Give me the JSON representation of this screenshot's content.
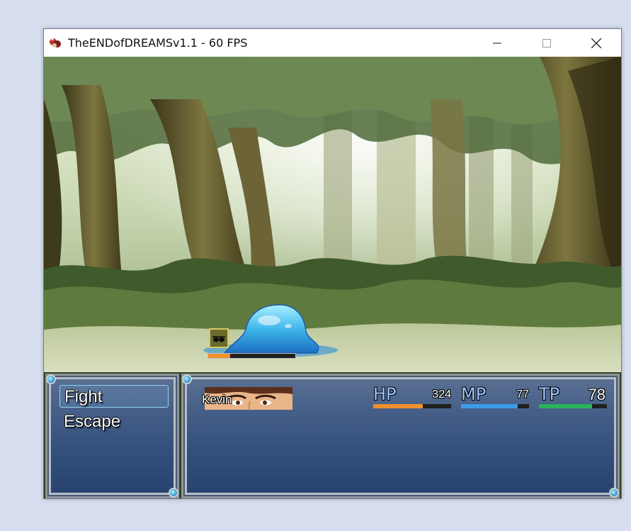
{
  "window": {
    "title": "TheENDofDREAMSv1.1 - 60 FPS",
    "controls": {
      "minimize_icon": "minimize-icon",
      "maximize_icon": "maximize-icon",
      "close_icon": "close-icon"
    }
  },
  "battle": {
    "commands": [
      {
        "label": "Fight",
        "selected": true
      },
      {
        "label": "Escape",
        "selected": false
      }
    ],
    "enemy": {
      "type": "slime",
      "state_icon": "sunglasses-icon",
      "gauge_fraction": 0.25
    },
    "actor": {
      "name": "Kevin",
      "hp_label": "HP",
      "hp": "324",
      "hp_fraction": 0.64,
      "mp_label": "MP",
      "mp": "77",
      "mp_fraction": 0.83,
      "tp_label": "TP",
      "tp": "78",
      "tp_fraction": 0.78
    }
  },
  "colors": {
    "hp_gauge": "#f0902c",
    "mp_gauge": "#3c9ce8",
    "tp_gauge": "#28b45a",
    "cursor_border": "#8fd6ef",
    "panel": "#2d4a77"
  }
}
